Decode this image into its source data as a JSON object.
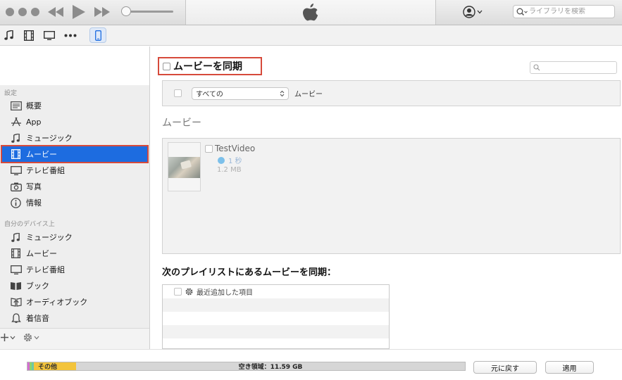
{
  "search": {
    "placeholder": "ライブラリを検索"
  },
  "sidebar": {
    "settings_header": "設定",
    "settings_items": [
      {
        "label": "概要",
        "icon": "summary-icon"
      },
      {
        "label": "App",
        "icon": "app-store-icon"
      },
      {
        "label": "ミュージック",
        "icon": "music-note-icon"
      },
      {
        "label": "ムービー",
        "icon": "film-icon",
        "selected": true
      },
      {
        "label": "テレビ番組",
        "icon": "tv-icon"
      },
      {
        "label": "写真",
        "icon": "camera-icon"
      },
      {
        "label": "情報",
        "icon": "info-icon"
      }
    ],
    "device_header": "自分のデバイス上",
    "device_items": [
      {
        "label": "ミュージック",
        "icon": "music-note-icon"
      },
      {
        "label": "ムービー",
        "icon": "film-icon"
      },
      {
        "label": "テレビ番組",
        "icon": "tv-icon"
      },
      {
        "label": "ブック",
        "icon": "book-icon"
      },
      {
        "label": "オーディオブック",
        "icon": "audiobook-icon"
      },
      {
        "label": "着信音",
        "icon": "bell-icon"
      }
    ]
  },
  "main": {
    "sync_label": "ムービーを同期",
    "filter": {
      "selected": "すべての",
      "suffix": "ムービー"
    },
    "movies_title": "ムービー",
    "movie": {
      "name": "TestVideo",
      "duration": "1 秒",
      "size": "1.2 MB"
    },
    "playlist_title": "次のプレイリストにあるムービーを同期：",
    "playlist_items": [
      "最近追加した項目"
    ]
  },
  "capacity": {
    "other_label": "その他",
    "free_label": "空き領域：11.59 GB",
    "colors": {
      "other": "#f3c43c",
      "free": "#d6d6d6"
    }
  },
  "buttons": {
    "revert": "元に戻す",
    "apply": "適用"
  },
  "colors": {
    "selection": "#1d6ce0",
    "highlight_border": "#d64a3b"
  }
}
